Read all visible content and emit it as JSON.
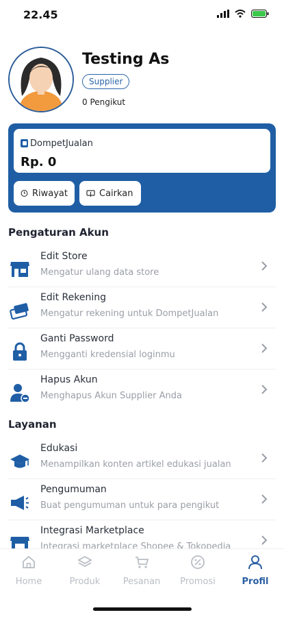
{
  "status": {
    "time": "22.45"
  },
  "profile": {
    "name": "Testing As",
    "role": "Supplier",
    "followers": "0 Pengikut"
  },
  "wallet": {
    "label": "DompetJualan",
    "balance": "Rp. 0",
    "history_label": "Riwayat",
    "withdraw_label": "Cairkan"
  },
  "sections": {
    "account": "Pengaturan Akun",
    "services": "Layanan"
  },
  "account_items": [
    {
      "title": "Edit Store",
      "subtitle": "Mengatur ulang data store",
      "icon": "store-icon"
    },
    {
      "title": "Edit Rekening",
      "subtitle": "Mengatur rekening untuk DompetJualan",
      "icon": "bank-card-icon"
    },
    {
      "title": "Ganti Password",
      "subtitle": "Mengganti kredensial loginmu",
      "icon": "lock-icon"
    },
    {
      "title": "Hapus Akun",
      "subtitle": "Menghapus Akun Supplier Anda",
      "icon": "user-remove-icon"
    }
  ],
  "service_items": [
    {
      "title": "Edukasi",
      "subtitle": "Menampilkan konten artikel edukasi jualan",
      "icon": "graduation-cap-icon"
    },
    {
      "title": "Pengumuman",
      "subtitle": "Buat pengumuman untuk para pengikut",
      "icon": "megaphone-icon"
    },
    {
      "title": "Integrasi Marketplace",
      "subtitle": "Integrasi marketplace Shopee & Tokopedia",
      "icon": "marketplace-icon"
    }
  ],
  "nav": [
    {
      "label": "Home",
      "icon": "home-icon",
      "active": false
    },
    {
      "label": "Produk",
      "icon": "layers-icon",
      "active": false
    },
    {
      "label": "Pesanan",
      "icon": "cart-icon",
      "active": false
    },
    {
      "label": "Promosi",
      "icon": "discount-icon",
      "active": false
    },
    {
      "label": "Profil",
      "icon": "user-icon",
      "active": true
    }
  ],
  "colors": {
    "primary": "#1f5ea5",
    "muted": "#b9bdc4",
    "icon": "#1f5ea5"
  }
}
